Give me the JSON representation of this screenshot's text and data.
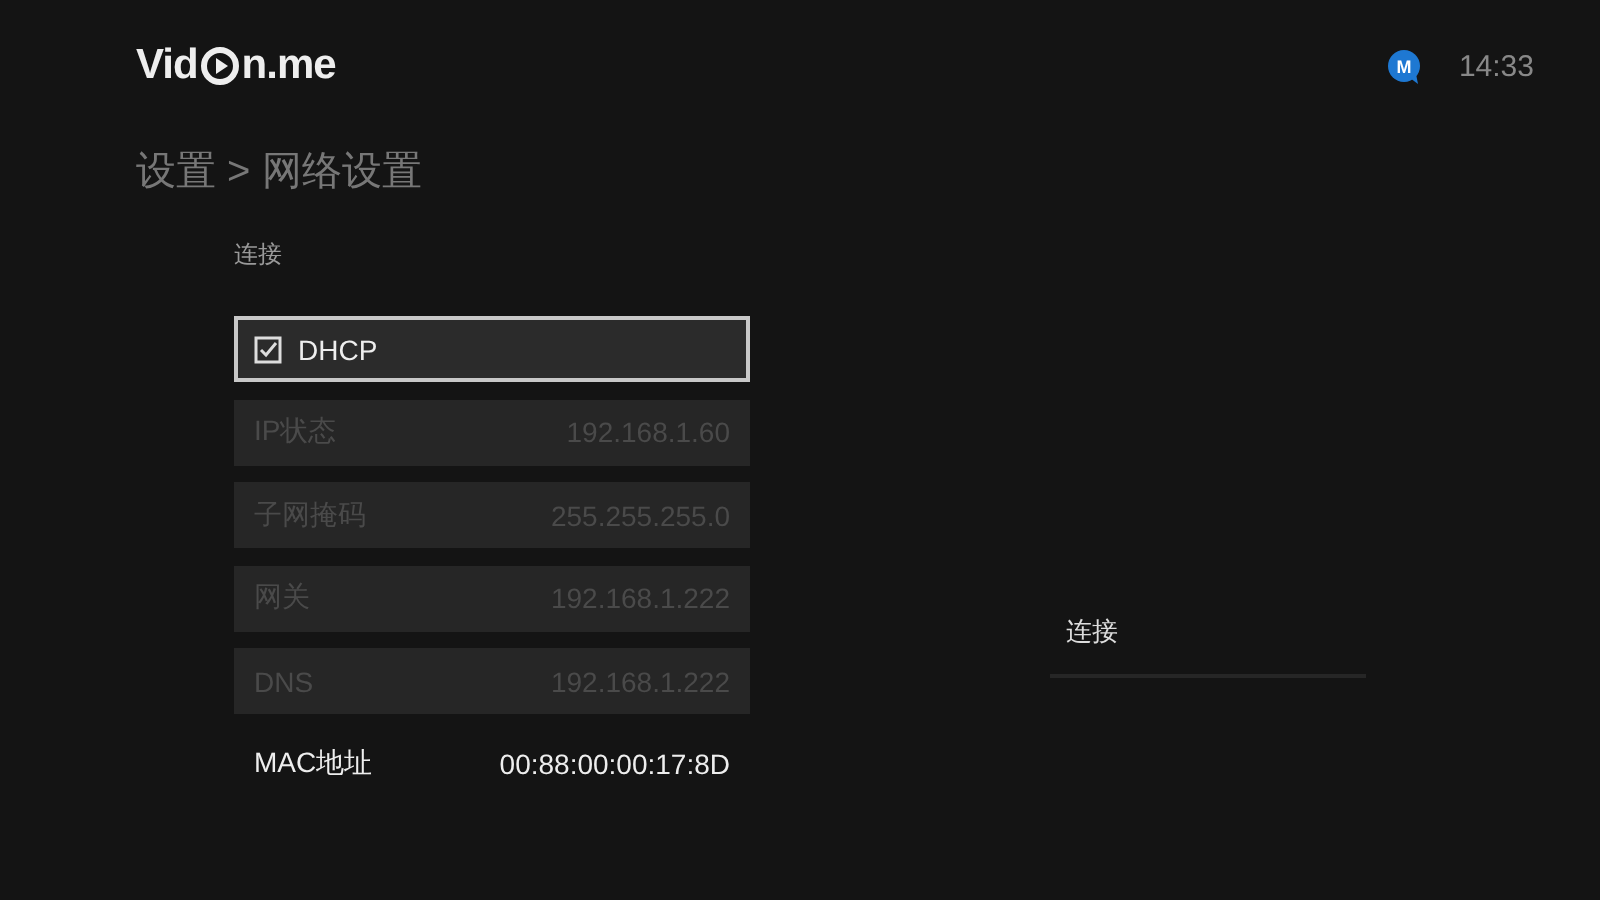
{
  "header": {
    "logo": {
      "before": "Vid",
      "after": "n.me"
    },
    "notification": {
      "badge": "M"
    },
    "time": "14:33"
  },
  "breadcrumb": "设置 > 网络设置",
  "section": {
    "title": "连接"
  },
  "rows": [
    {
      "kind": "checkbox",
      "label": "DHCP",
      "checked": true,
      "selected": true,
      "disabled": false
    },
    {
      "kind": "field",
      "label": "IP状态",
      "value": "192.168.1.60",
      "selected": false,
      "disabled": true
    },
    {
      "kind": "field",
      "label": "子网掩码",
      "value": "255.255.255.0",
      "selected": false,
      "disabled": true
    },
    {
      "kind": "field",
      "label": "网关",
      "value": "192.168.1.222",
      "selected": false,
      "disabled": true
    },
    {
      "kind": "field",
      "label": "DNS",
      "value": "192.168.1.222",
      "selected": false,
      "disabled": true
    },
    {
      "kind": "info",
      "label": "MAC地址",
      "value": "00:88:00:00:17:8D"
    }
  ],
  "side_menu": {
    "items": [
      {
        "label": "连接"
      }
    ]
  }
}
